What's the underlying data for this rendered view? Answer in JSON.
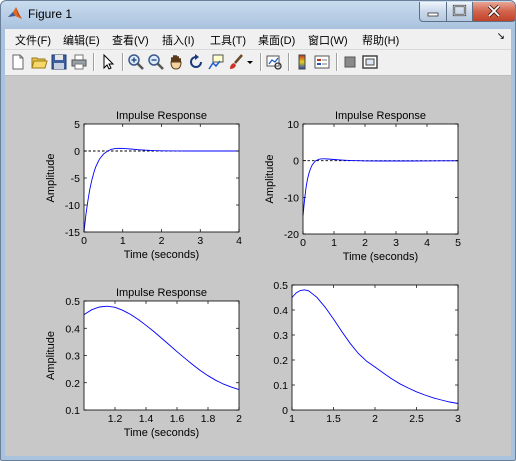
{
  "window": {
    "title": "Figure 1",
    "caption_buttons": [
      "minimize-icon",
      "maximize-icon",
      "close-icon"
    ]
  },
  "menu": [
    "文件(F)",
    "编辑(E)",
    "查看(V)",
    "插入(I)",
    "工具(T)",
    "桌面(D)",
    "窗口(W)",
    "帮助(H)"
  ],
  "toolbar": {
    "icons": [
      "new-file-icon",
      "open-folder-icon",
      "save-icon",
      "print-icon",
      "pointer-icon",
      "zoom-in-icon",
      "zoom-out-icon",
      "pan-hand-icon",
      "rotate-3d-icon",
      "data-cursor-icon",
      "brush-icon",
      "brush-dropdown-icon",
      "link-plot-icon",
      "colorbar-icon",
      "legend-icon",
      "hide-plot-tools-icon",
      "show-plot-tools-icon"
    ]
  },
  "colors": {
    "figure_bg": "#c8c8c8",
    "axes_bg": "#ffffff",
    "line": "#0000ff",
    "title_close": "#c7482f"
  },
  "chart_data": [
    {
      "type": "line",
      "title": "Impulse Response",
      "xlabel": "Time (seconds)",
      "ylabel": "Amplitude",
      "xlim": [
        0,
        4
      ],
      "ylim": [
        -15,
        5
      ],
      "xticks": [
        0,
        1,
        2,
        3,
        4
      ],
      "yticks": [
        -15,
        -10,
        -5,
        0,
        5
      ],
      "zero_line": true,
      "series": [
        {
          "x": [
            0,
            0.05,
            0.1,
            0.15,
            0.2,
            0.25,
            0.3,
            0.35,
            0.4,
            0.5,
            0.6,
            0.7,
            0.8,
            0.9,
            1.0,
            1.1,
            1.2,
            1.4,
            1.6,
            1.8,
            2.0,
            2.4,
            2.8,
            3.2,
            3.6,
            4.0
          ],
          "y": [
            -15,
            -11.8,
            -9.2,
            -7.1,
            -5.4,
            -4.1,
            -3.0,
            -2.2,
            -1.5,
            -0.6,
            -0.05,
            0.3,
            0.45,
            0.5,
            0.48,
            0.43,
            0.37,
            0.25,
            0.15,
            0.08,
            0.04,
            0.01,
            0,
            0,
            0,
            0
          ]
        }
      ]
    },
    {
      "type": "line",
      "title": "Impulse Response",
      "xlabel": "Time (seconds)",
      "ylabel": "Amplitude",
      "xlim": [
        0,
        5
      ],
      "ylim": [
        -20,
        10
      ],
      "xticks": [
        0,
        1,
        2,
        3,
        4,
        5
      ],
      "yticks": [
        -20,
        -10,
        0,
        10
      ],
      "zero_line": true,
      "series": [
        {
          "x": [
            0,
            0.05,
            0.1,
            0.15,
            0.2,
            0.25,
            0.3,
            0.4,
            0.5,
            0.6,
            0.7,
            0.8,
            1.0,
            1.2,
            1.4,
            1.6,
            1.8,
            2.0,
            2.5,
            3.0,
            3.5,
            4.0,
            4.5,
            5.0
          ],
          "y": [
            -15,
            -10.5,
            -7.2,
            -4.9,
            -3.2,
            -2.0,
            -1.1,
            -0.1,
            0.35,
            0.5,
            0.5,
            0.45,
            0.32,
            0.2,
            0.1,
            0.03,
            -0.02,
            -0.05,
            -0.1,
            -0.1,
            -0.08,
            -0.06,
            -0.04,
            -0.03
          ]
        }
      ]
    },
    {
      "type": "line",
      "title": "Impulse Response",
      "xlabel": "Time (seconds)",
      "ylabel": "Amplitude",
      "xlim": [
        1,
        2
      ],
      "ylim": [
        0.1,
        0.5
      ],
      "xticks": [
        1.2,
        1.4,
        1.6,
        1.8,
        2
      ],
      "yticks": [
        0.1,
        0.2,
        0.3,
        0.4,
        0.5
      ],
      "zero_line": false,
      "series": [
        {
          "x": [
            1.0,
            1.05,
            1.1,
            1.15,
            1.2,
            1.25,
            1.3,
            1.35,
            1.4,
            1.45,
            1.5,
            1.55,
            1.6,
            1.65,
            1.7,
            1.75,
            1.8,
            1.85,
            1.9,
            1.95,
            2.0
          ],
          "y": [
            0.45,
            0.468,
            0.478,
            0.481,
            0.477,
            0.466,
            0.451,
            0.432,
            0.411,
            0.388,
            0.364,
            0.339,
            0.314,
            0.29,
            0.267,
            0.245,
            0.226,
            0.209,
            0.195,
            0.184,
            0.175
          ]
        }
      ]
    },
    {
      "type": "line",
      "title": "",
      "xlabel": "",
      "ylabel": "",
      "xlim": [
        1,
        3
      ],
      "ylim": [
        0,
        0.5
      ],
      "xticks": [
        1,
        1.5,
        2,
        2.5,
        3
      ],
      "yticks": [
        0,
        0.1,
        0.2,
        0.3,
        0.4,
        0.5
      ],
      "zero_line": false,
      "series": [
        {
          "x": [
            1.0,
            1.05,
            1.1,
            1.15,
            1.2,
            1.3,
            1.4,
            1.5,
            1.6,
            1.7,
            1.8,
            1.9,
            2.0,
            2.1,
            2.2,
            2.3,
            2.4,
            2.5,
            2.6,
            2.7,
            2.8,
            2.9,
            3.0
          ],
          "y": [
            0.45,
            0.468,
            0.478,
            0.481,
            0.477,
            0.451,
            0.411,
            0.364,
            0.314,
            0.267,
            0.226,
            0.195,
            0.172,
            0.148,
            0.125,
            0.105,
            0.088,
            0.073,
            0.06,
            0.049,
            0.04,
            0.032,
            0.026
          ]
        }
      ]
    }
  ]
}
